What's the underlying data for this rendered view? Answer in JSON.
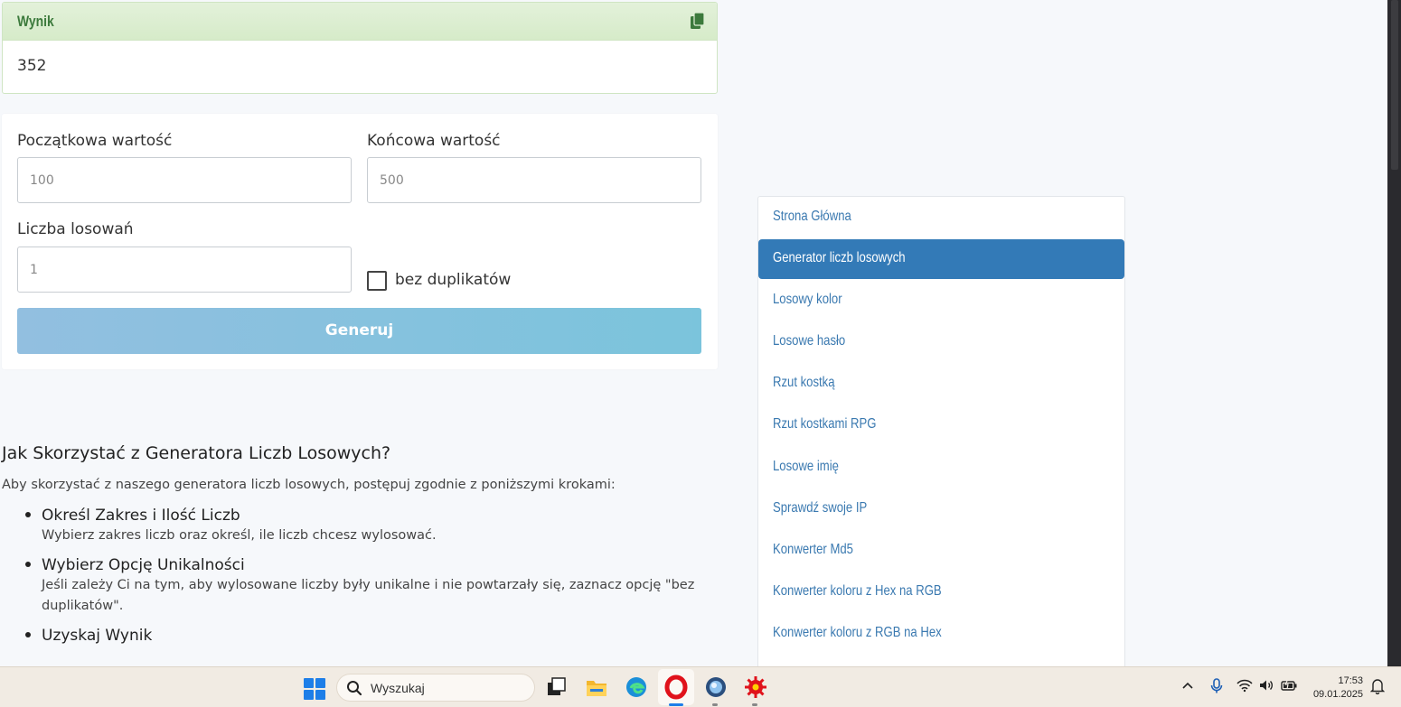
{
  "result": {
    "title": "Wynik",
    "value": "352"
  },
  "form": {
    "start_label": "Początkowa wartość",
    "start_placeholder": "100",
    "end_label": "Końcowa wartość",
    "end_placeholder": "500",
    "count_label": "Liczba losowań",
    "count_placeholder": "1",
    "no_duplicates_label": "bez duplikatów",
    "no_duplicates_checked": false,
    "generate_label": "Generuj"
  },
  "article": {
    "title": "Jak Skorzystać z Generatora Liczb Losowych?",
    "intro": "Aby skorzystać z naszego generatora liczb losowych, postępuj zgodnie z poniższymi krokami:",
    "steps": [
      {
        "title": "Określ Zakres i Ilość Liczb",
        "desc": "Wybierz zakres liczb oraz określ, ile liczb chcesz wylosować."
      },
      {
        "title": "Wybierz Opcję Unikalności",
        "desc": "Jeśli zależy Ci na tym, aby wylosowane liczby były unikalne i nie powtarzały się, zaznacz opcję \"bez duplikatów\"."
      },
      {
        "title": "Uzyskaj Wynik",
        "desc": ""
      }
    ]
  },
  "sidebar": {
    "active_index": 1,
    "items": [
      {
        "label": "Strona Główna"
      },
      {
        "label": "Generator liczb losowych"
      },
      {
        "label": "Losowy kolor"
      },
      {
        "label": "Losowe hasło"
      },
      {
        "label": "Rzut kostką"
      },
      {
        "label": "Rzut kostkami RPG"
      },
      {
        "label": "Losowe imię"
      },
      {
        "label": "Sprawdź swoje IP"
      },
      {
        "label": "Konwerter Md5"
      },
      {
        "label": "Konwerter koloru z Hex na RGB"
      },
      {
        "label": "Konwerter koloru z RGB na Hex"
      }
    ]
  },
  "taskbar": {
    "search_placeholder": "Wyszukaj",
    "time": "17:53",
    "date": "09.01.2025",
    "apps": [
      "task-view-icon",
      "file-explorer-icon",
      "edge-icon",
      "opera-icon",
      "browser-icon",
      "red-gear-app-icon"
    ]
  },
  "colors": {
    "accent": "#337ab7",
    "result_header": "#d6ebc9",
    "button": "#7bc4dc"
  }
}
